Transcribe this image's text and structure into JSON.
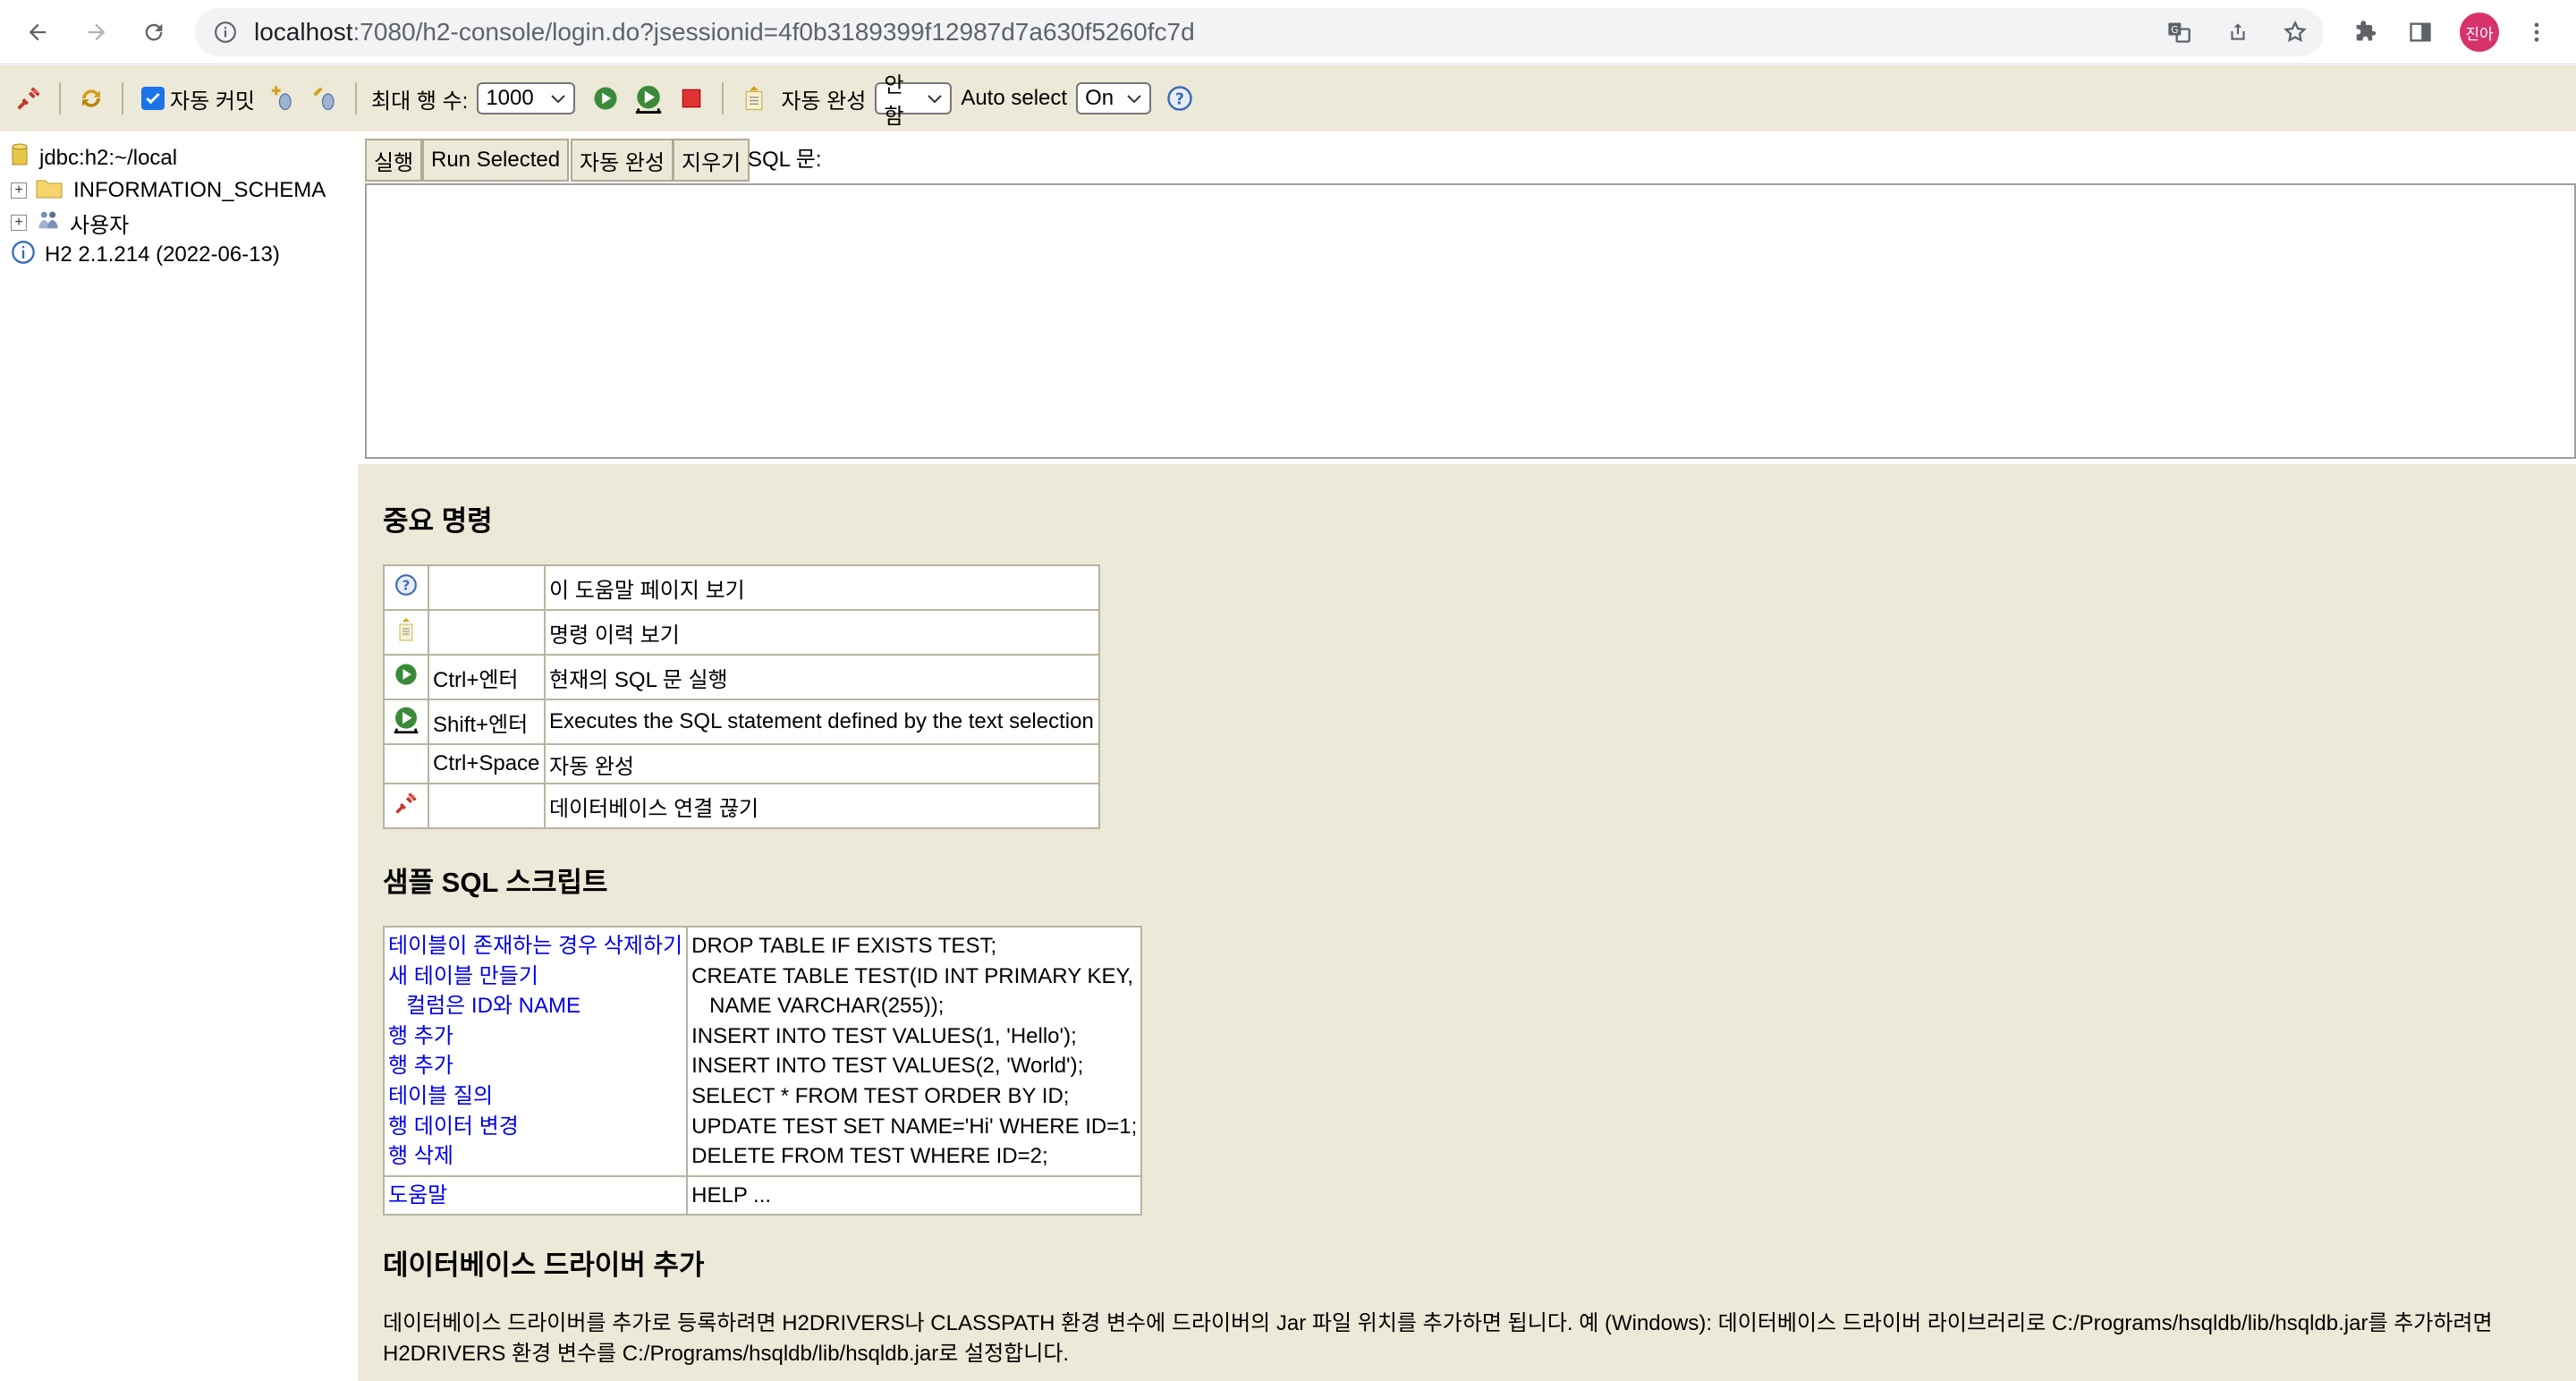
{
  "browser": {
    "url_host": "localhost",
    "url_rest": ":7080/h2-console/login.do?jsessionid=4f0b3189399f12987d7a630f5260fc7d",
    "profile_initials": "진아",
    "icons": [
      "back-arrow-icon",
      "forward-arrow-icon",
      "reload-icon",
      "info-icon",
      "translate-icon",
      "share-icon",
      "star-icon",
      "extensions-icon",
      "side-panel-icon",
      "kebab-menu-icon"
    ]
  },
  "toolbar": {
    "autocommit_label": "자동 커밋",
    "max_rows_label": "최대 행 수:",
    "max_rows_value": "1000",
    "autocomplete_label": "자동 완성",
    "autocomplete_value": "안함",
    "autoselect_label": "Auto select",
    "autoselect_value": "On"
  },
  "tree": {
    "items": [
      {
        "label": "jdbc:h2:~/local",
        "icon": "database-icon"
      },
      {
        "label": "INFORMATION_SCHEMA",
        "icon": "folder-icon"
      },
      {
        "label": "사용자",
        "icon": "users-icon"
      },
      {
        "label": "H2 2.1.214 (2022-06-13)",
        "icon": "info-icon"
      }
    ]
  },
  "query": {
    "run_label": "실행",
    "run_selected_label": "Run Selected",
    "autocomplete_label": "자동 완성",
    "clear_label": "지우기",
    "sql_label": "SQL 문:"
  },
  "help": {
    "important_title": "중요 명령",
    "commands": [
      {
        "icon": "help-icon",
        "key": "",
        "desc": "이 도움말 페이지 보기"
      },
      {
        "icon": "history-icon",
        "key": "",
        "desc": "명령 이력 보기"
      },
      {
        "icon": "run-icon",
        "key": "Ctrl+엔터",
        "desc": "현재의 SQL 문 실행"
      },
      {
        "icon": "run-selected-icon",
        "key": "Shift+엔터",
        "desc": "Executes the SQL statement defined by the text selection"
      },
      {
        "icon": "",
        "key": "Ctrl+Space",
        "desc": "자동 완성"
      },
      {
        "icon": "disconnect-icon",
        "key": "",
        "desc": "데이터베이스 연결 끊기"
      }
    ],
    "samples_title": "샘플 SQL 스크립트",
    "samples": [
      {
        "label": "테이블이 존재하는 경우 삭제하기",
        "sql": "DROP TABLE IF EXISTS TEST;"
      },
      {
        "label": "새 테이블 만들기",
        "sql": "CREATE TABLE TEST(ID INT PRIMARY KEY,"
      },
      {
        "label": "컬럼은 ID와 NAME",
        "sql": "NAME VARCHAR(255));"
      },
      {
        "label": "행 추가",
        "sql": "INSERT INTO TEST VALUES(1, 'Hello');"
      },
      {
        "label": "행 추가",
        "sql": "INSERT INTO TEST VALUES(2, 'World');"
      },
      {
        "label": "테이블 질의",
        "sql": "SELECT * FROM TEST ORDER BY ID;"
      },
      {
        "label": "행 데이터 변경",
        "sql": "UPDATE TEST SET NAME='Hi' WHERE ID=1;"
      },
      {
        "label": "행 삭제",
        "sql": "DELETE FROM TEST WHERE ID=2;"
      }
    ],
    "help_row": {
      "label": "도움말",
      "sql": "HELP ..."
    },
    "driver_title": "데이터베이스 드라이버 추가",
    "driver_text": "데이터베이스 드라이버를 추가로 등록하려면 H2DRIVERS나 CLASSPATH 환경 변수에 드라이버의 Jar 파일 위치를 추가하면 됩니다. 예 (Windows): 데이터베이스 드라이버 라이브러리로 C:/Programs/hsqldb/lib/hsqldb.jar를 추가하려면 H2DRIVERS 환경 변수를 C:/Programs/hsqldb/lib/hsqldb.jar로 설정합니다."
  }
}
